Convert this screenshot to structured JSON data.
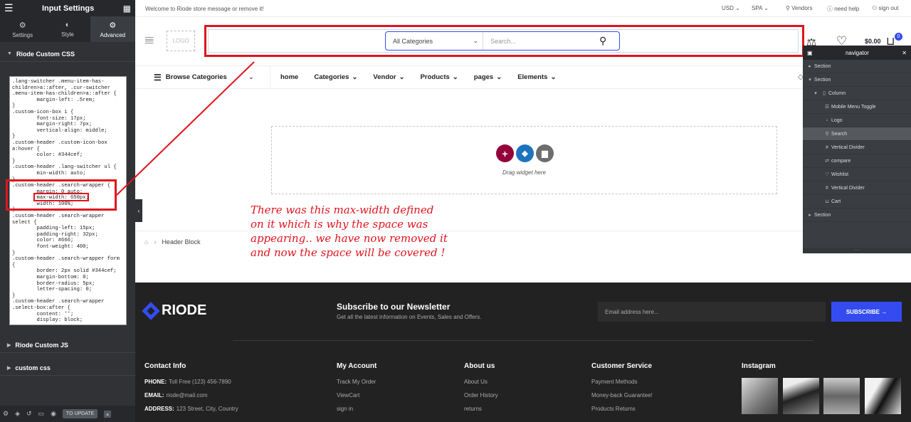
{
  "panel": {
    "title": "Input Settings",
    "tabs": [
      {
        "label": "Settings",
        "icon": "gear-icon"
      },
      {
        "label": "Style",
        "icon": "half-circle-icon"
      },
      {
        "label": "Advanced",
        "icon": "gear-icon"
      }
    ],
    "section_css": "Riode Custom CSS",
    "section_js": "Riode Custom JS",
    "section_custom": "custom css",
    "code": ".lang-switcher .menu-item-has-\nchildren>a::after, .cur-switcher\n.menu-item-has-children>a::after {\n        margin-left: .5rem;\n}\n.custom-icon-box i {\n        font-size: 17px;\n        margin-right: 7px;\n        vertical-align: middle;\n}\n.custom-header .custom-icon-box\na:hover {\n        color: #344cef;\n}\n.custom-header .lang-switcher ul {\n        min-width: auto;\n}\n.custom-header .search-wrapper {\n        margin: 0 auto;\n        max-width: 650px;\n        width: 100%;\n}\n.custom-header .search-wrapper\nselect {\n        padding-left: 15px;\n        padding-right: 32px;\n        color: #666;\n        font-weight: 400;\n}\n.custom-header .search-wrapper form\n{\n        border: 2px solid #344cef;\n        margin-bottom: 0;\n        border-radius: 5px;\n        letter-spacing: 0;\n}\n.custom-header .search-wrapper\n.select-box:after {\n        content: '';\n        display: block;",
    "update_label": "TO UPDATE"
  },
  "topbar": {
    "welcome": "Welcome to Riode store message or remove it!",
    "currency": "USD",
    "language": "SPA",
    "vendors": "Vendors",
    "help": "need help",
    "signout": "sign out"
  },
  "header": {
    "logo": "LOGO",
    "category": "All Categories",
    "search_placeholder": "Search...",
    "cart_total": "$0.00",
    "cart_count": "0"
  },
  "nav": {
    "browse": "Browse Categories",
    "items": [
      "home",
      "Categories",
      "Vendor",
      "Products",
      "pages",
      "Elements"
    ]
  },
  "drop_text": "Drag widget here",
  "breadcrumb": "Header Block",
  "annotation": "There was this max-width defined on it which is why the space was appearing.. we have now removed it and now the space will be covered !",
  "footer": {
    "brand": "RIODE",
    "subscribe_title": "Subscribe to our Newsletter",
    "subscribe_desc": "Get all the latest information on Events, Sales and Offers.",
    "email_placeholder": "Email address here...",
    "subscribe_btn": "SUBSCRIBE →",
    "contact": {
      "title": "Contact Info",
      "phone_label": "PHONE:",
      "phone": "Toll Free (123) 456-7890",
      "email_label": "EMAIL:",
      "email": "riode@mail.com",
      "address_label": "ADDRESS:",
      "address": "123 Street, City, Country"
    },
    "account": {
      "title": "My Account",
      "links": [
        "Track My Order",
        "ViewCart",
        "sign in"
      ]
    },
    "about": {
      "title": "About us",
      "links": [
        "About Us",
        "Order History",
        "returns"
      ]
    },
    "service": {
      "title": "Customer Service",
      "links": [
        "Payment Methods",
        "Money-back Guarantee!",
        "Products Returns"
      ]
    },
    "instagram": {
      "title": "Instagram"
    }
  },
  "navigator": {
    "title": "navigator",
    "rows": [
      "Section",
      "Section",
      "Column",
      "Mobile Menu Toggle",
      "Logo",
      "Search",
      "Vertical Divider",
      "compare",
      "Wishlist",
      "Vertical Divider",
      "Cart",
      "Section"
    ]
  },
  "colors": {
    "accent": "#344cef",
    "annotation": "#e0141e",
    "add": "#93003a",
    "nav": "#3a3d42"
  }
}
